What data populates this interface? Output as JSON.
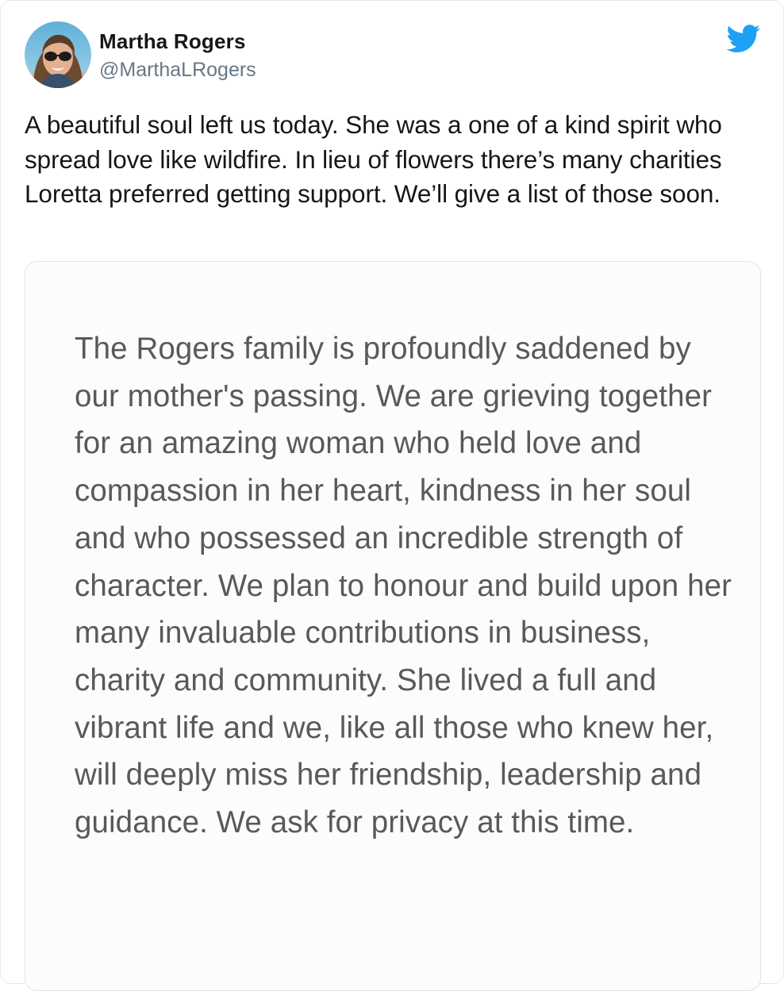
{
  "tweet": {
    "author": {
      "name": "Martha Rogers",
      "handle": "@MarthaLRogers"
    },
    "platform_icon": "twitter-bird-icon",
    "accent_color": "#1da1f2",
    "text": "A beautiful soul left us today. She was a one of a kind spirit who spread love like wildfire. In lieu of flowers there’s many charities Loretta preferred getting support. We’ll give a list of those soon.",
    "media": {
      "statement_text": "The Rogers family is profoundly saddened by our mother's passing. We are grieving together for an amazing woman who held love and compassion in her heart, kindness in her soul and who possessed an incredible strength of character. We plan to honour and build upon her many invaluable contributions in business, charity and community. She lived a full and vibrant life and we, like all those who knew her, will deeply miss her friendship, leadership and guidance. We ask for privacy at this time."
    }
  }
}
